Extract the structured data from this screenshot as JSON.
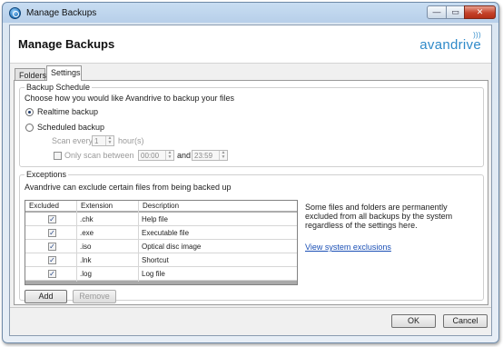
{
  "window": {
    "title": "Manage Backups",
    "minimize": "—",
    "maximize": "▭",
    "close": "✕"
  },
  "header": {
    "title": "Manage Backups",
    "logo": "avandrive"
  },
  "tabs": [
    {
      "label": "Folders"
    },
    {
      "label": "Settings",
      "selected": true
    }
  ],
  "schedule": {
    "legend": "Backup Schedule",
    "intro": "Choose how you would like Avandrive to backup your files",
    "realtime_label": "Realtime backup",
    "scheduled_label": "Scheduled backup",
    "scan_every_label": "Scan every",
    "scan_every_value": "1",
    "hours_label": "hour(s)",
    "only_scan_label": "Only scan between",
    "start_time": "00:00",
    "and_label": "and",
    "end_time": "23:59"
  },
  "exceptions": {
    "legend": "Exceptions",
    "intro": "Avandrive can exclude certain files from being backed up",
    "columns": {
      "excluded": "Excluded",
      "extension": "Extension",
      "description": "Description"
    },
    "rows": [
      {
        "excluded": "✓",
        "extension": ".chk",
        "description": "Help file"
      },
      {
        "excluded": "✓",
        "extension": ".exe",
        "description": "Executable file"
      },
      {
        "excluded": "✓",
        "extension": ".iso",
        "description": "Optical disc image"
      },
      {
        "excluded": "✓",
        "extension": ".lnk",
        "description": "Shortcut"
      },
      {
        "excluded": "✓",
        "extension": ".log",
        "description": "Log file"
      }
    ],
    "add_label": "Add",
    "remove_label": "Remove",
    "note_line1": "Some files and folders are permanently",
    "note_line2": "excluded from all backups by the system",
    "note_line3": "regardless of the settings here.",
    "link_label": "View system exclusions"
  },
  "footer": {
    "ok_label": "OK",
    "cancel_label": "Cancel"
  },
  "colors": {
    "accent": "#2f8ac9",
    "link": "#1a4fb5",
    "close": "#c5432b"
  }
}
